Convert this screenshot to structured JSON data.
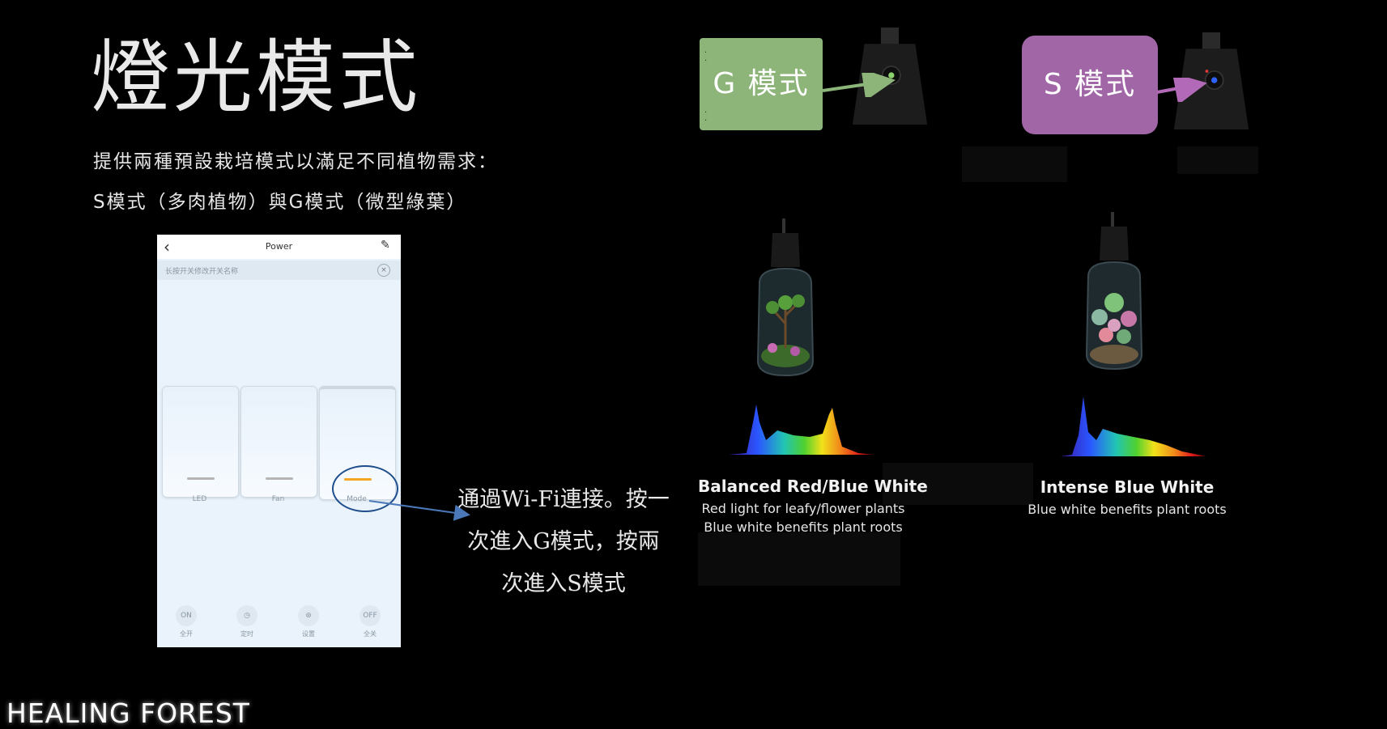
{
  "slide": {
    "title": "燈光模式",
    "intro_line1": "提供兩種預設栽培模式以滿足不同植物需求：",
    "intro_line2": "S模式（多肉植物）與G模式（微型綠葉）"
  },
  "phone": {
    "header_title": "Power",
    "back_icon": "chevron-left-icon",
    "edit_icon": "pencil-icon",
    "hint": "长按开关修改开关名称",
    "close_icon": "close-circle-icon",
    "switches": [
      {
        "label": "LED",
        "state": "off"
      },
      {
        "label": "Fan",
        "state": "off"
      },
      {
        "label": "Mode",
        "state": "on"
      }
    ],
    "bottom_buttons": [
      {
        "icon_text": "ON",
        "label": "全开"
      },
      {
        "icon_text": "◷",
        "label": "定时"
      },
      {
        "icon_text": "⊛",
        "label": "设置"
      },
      {
        "icon_text": "OFF",
        "label": "全关"
      }
    ],
    "accent_color": "#f5a623"
  },
  "callout": {
    "line1": "通過Wi-Fi連接。按一",
    "line2": "次進入G模式，按兩",
    "line3": "次進入S模式"
  },
  "modes": {
    "g": {
      "box_label": "G 模式",
      "box_color": "#8db57a",
      "heading": "Balanced Red/Blue White",
      "desc_line1": "Red light for leafy/flower plants",
      "desc_line2": "Blue white benefits plant roots"
    },
    "s": {
      "box_label": "S 模式",
      "box_color": "#a066a6",
      "heading": "Intense Blue White",
      "desc_line1": "Blue white benefits plant roots"
    }
  },
  "brand": {
    "name": "HEALING FOREST"
  }
}
